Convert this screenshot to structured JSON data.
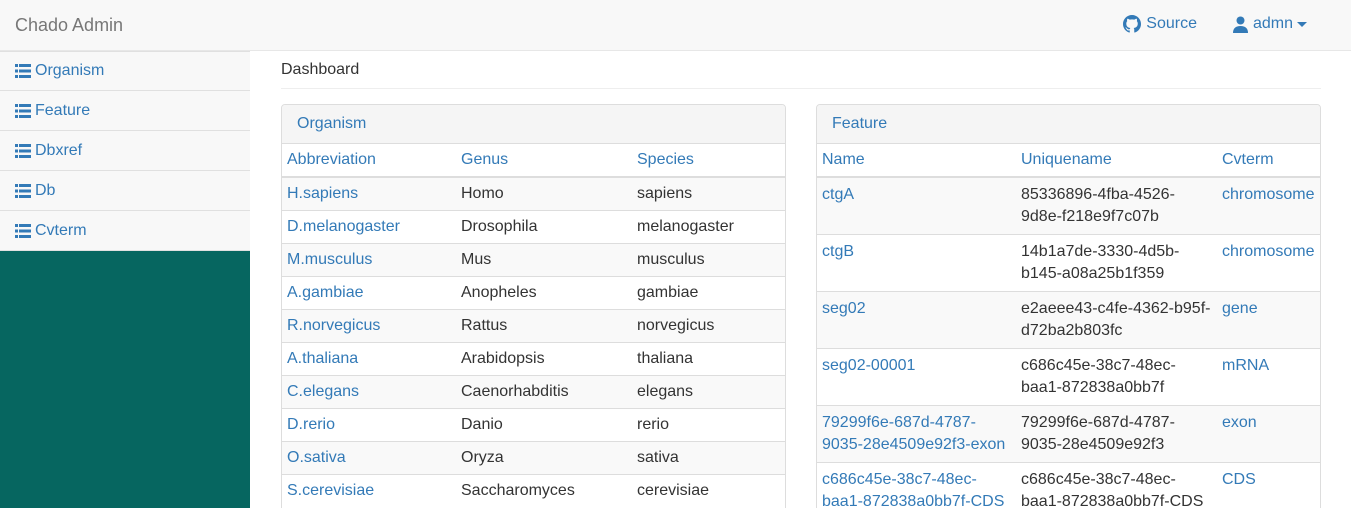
{
  "navbar": {
    "brand": "Chado Admin",
    "source_label": "Source",
    "user_label": "admn"
  },
  "sidebar": {
    "items": [
      {
        "label": "Organism"
      },
      {
        "label": "Feature"
      },
      {
        "label": "Dbxref"
      },
      {
        "label": "Db"
      },
      {
        "label": "Cvterm"
      }
    ]
  },
  "main": {
    "title": "Dashboard",
    "organism_panel": {
      "heading": "Organism",
      "columns": [
        "Abbreviation",
        "Genus",
        "Species"
      ],
      "rows": [
        [
          "H.sapiens",
          "Homo",
          "sapiens"
        ],
        [
          "D.melanogaster",
          "Drosophila",
          "melanogaster"
        ],
        [
          "M.musculus",
          "Mus",
          "musculus"
        ],
        [
          "A.gambiae",
          "Anopheles",
          "gambiae"
        ],
        [
          "R.norvegicus",
          "Rattus",
          "norvegicus"
        ],
        [
          "A.thaliana",
          "Arabidopsis",
          "thaliana"
        ],
        [
          "C.elegans",
          "Caenorhabditis",
          "elegans"
        ],
        [
          "D.rerio",
          "Danio",
          "rerio"
        ],
        [
          "O.sativa",
          "Oryza",
          "sativa"
        ],
        [
          "S.cerevisiae",
          "Saccharomyces",
          "cerevisiae"
        ]
      ]
    },
    "feature_panel": {
      "heading": "Feature",
      "columns": [
        "Name",
        "Uniquename",
        "Cvterm"
      ],
      "rows": [
        [
          "ctgA",
          "85336896-4fba-4526-9d8e-f218e9f7c07b",
          "chromosome"
        ],
        [
          "ctgB",
          "14b1a7de-3330-4d5b-b145-a08a25b1f359",
          "chromosome"
        ],
        [
          "seg02",
          "e2aeee43-c4fe-4362-b95f-d72ba2b803fc",
          "gene"
        ],
        [
          "seg02-00001",
          "c686c45e-38c7-48ec-baa1-872838a0bb7f",
          "mRNA"
        ],
        [
          "79299f6e-687d-4787-9035-28e4509e92f3-exon",
          "79299f6e-687d-4787-9035-28e4509e92f3",
          "exon"
        ],
        [
          "c686c45e-38c7-48ec-baa1-872838a0bb7f-CDS",
          "c686c45e-38c7-48ec-baa1-872838a0bb7f-CDS",
          "CDS"
        ]
      ]
    }
  },
  "colors": {
    "link": "#337ab7",
    "sidebar_bg": "#066660",
    "navbar_bg": "#f8f8f8"
  }
}
